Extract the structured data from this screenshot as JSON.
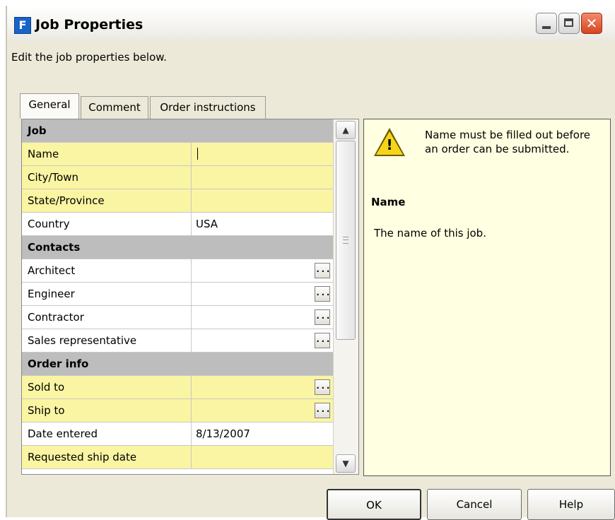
{
  "window": {
    "title": "Job Properties",
    "icon": "app-logo-icon",
    "instruction": "Edit the job properties below."
  },
  "tabs": [
    {
      "label": "General",
      "selected": true
    },
    {
      "label": "Comment",
      "selected": false
    },
    {
      "label": "Order instructions",
      "selected": false
    }
  ],
  "grid": {
    "categories": {
      "job": "Job",
      "contacts": "Contacts",
      "order_info": "Order info"
    },
    "rows": {
      "name": {
        "label": "Name",
        "value": ""
      },
      "city": {
        "label": "City/Town",
        "value": ""
      },
      "state": {
        "label": "State/Province",
        "value": ""
      },
      "country": {
        "label": "Country",
        "value": "USA"
      },
      "architect": {
        "label": "Architect",
        "value": ""
      },
      "engineer": {
        "label": "Engineer",
        "value": ""
      },
      "contractor": {
        "label": "Contractor",
        "value": ""
      },
      "sales_rep": {
        "label": "Sales representative",
        "value": ""
      },
      "sold_to": {
        "label": "Sold to",
        "value": ""
      },
      "ship_to": {
        "label": "Ship to",
        "value": ""
      },
      "date_entered": {
        "label": "Date entered",
        "value": "8/13/2007"
      },
      "requested_ship_date": {
        "label": "Requested ship date",
        "value": ""
      }
    },
    "ellipsis": "..."
  },
  "help": {
    "warning": "Name must be filled out before an order can be submitted.",
    "heading": "Name",
    "description": "The name of this job."
  },
  "buttons": {
    "ok": "OK",
    "cancel": "Cancel",
    "help": "Help"
  },
  "colors": {
    "required_row": "#faf5a2",
    "category_row": "#bdbdbd",
    "help_panel": "#ffffe1",
    "close_button": "#d5451f"
  }
}
